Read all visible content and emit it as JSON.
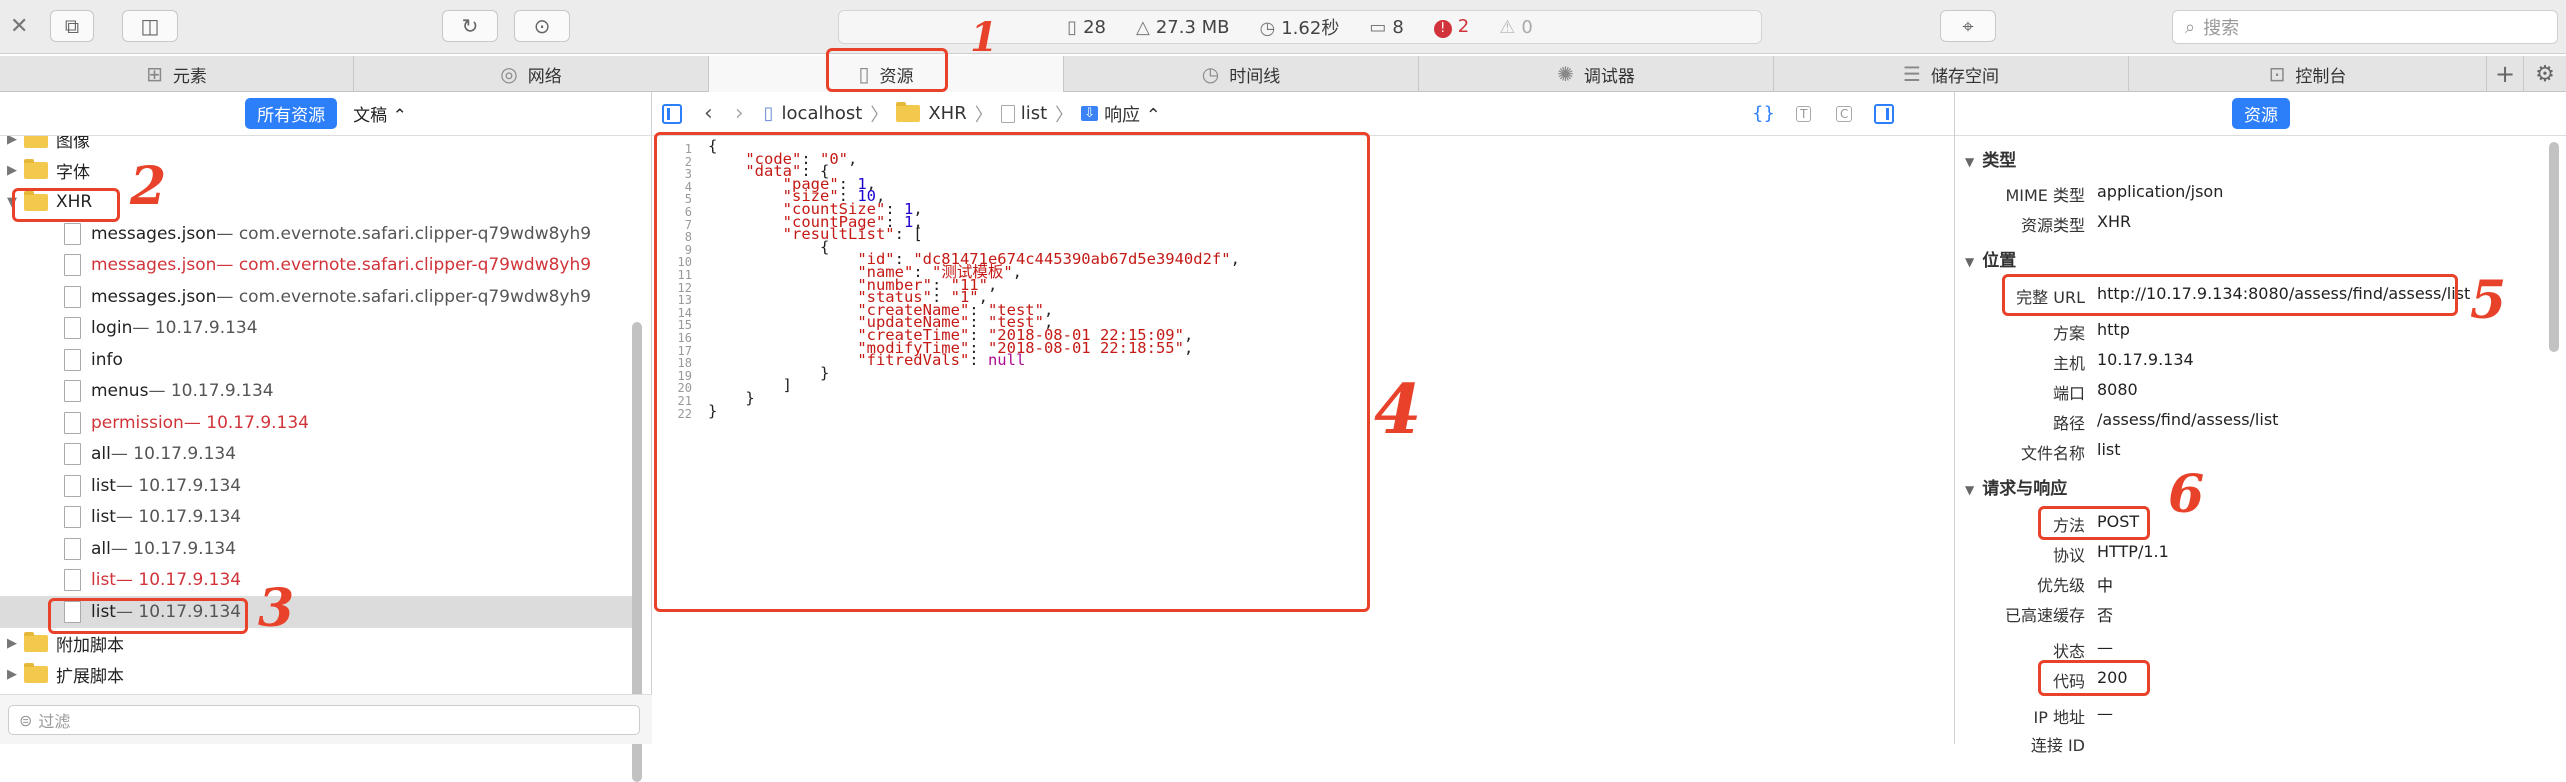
{
  "toolbar": {
    "stats": {
      "requests": "28",
      "size": "27.3 MB",
      "time": "1.62秒",
      "logs": "8",
      "errors": "2",
      "warnings": "0"
    },
    "search_placeholder": "搜索"
  },
  "tabs": [
    {
      "label": "元素",
      "icon": "elements-icon"
    },
    {
      "label": "网络",
      "icon": "network-icon"
    },
    {
      "label": "资源",
      "icon": "resources-icon"
    },
    {
      "label": "时间线",
      "icon": "timeline-icon"
    },
    {
      "label": "调试器",
      "icon": "debugger-icon"
    },
    {
      "label": "储存空间",
      "icon": "storage-icon"
    },
    {
      "label": "控制台",
      "icon": "console-icon"
    }
  ],
  "left": {
    "all_resources": "所有资源",
    "doc_filter": "文稿 ⌃",
    "tree": [
      {
        "label": "图像",
        "meta": "",
        "type": "folder",
        "red": false
      },
      {
        "label": "字体",
        "meta": "",
        "type": "folder",
        "red": false
      },
      {
        "label": "XHR",
        "meta": "",
        "type": "folder",
        "red": false
      },
      {
        "label": "messages.json",
        "meta": " — com.evernote.safari.clipper-q79wdw8yh9",
        "type": "file",
        "red": false
      },
      {
        "label": "messages.json",
        "meta": " — com.evernote.safari.clipper-q79wdw8yh9",
        "type": "file",
        "red": true
      },
      {
        "label": "messages.json",
        "meta": " — com.evernote.safari.clipper-q79wdw8yh9",
        "type": "file",
        "red": false
      },
      {
        "label": "login",
        "meta": " — 10.17.9.134",
        "type": "file",
        "red": false
      },
      {
        "label": "info",
        "meta": "",
        "type": "file",
        "red": false
      },
      {
        "label": "menus",
        "meta": " — 10.17.9.134",
        "type": "file",
        "red": false
      },
      {
        "label": "permission",
        "meta": " — 10.17.9.134",
        "type": "file",
        "red": true
      },
      {
        "label": "all",
        "meta": " — 10.17.9.134",
        "type": "file",
        "red": false
      },
      {
        "label": "list",
        "meta": " — 10.17.9.134",
        "type": "file",
        "red": false
      },
      {
        "label": "list",
        "meta": " — 10.17.9.134",
        "type": "file",
        "red": false
      },
      {
        "label": "all",
        "meta": " — 10.17.9.134",
        "type": "file",
        "red": false
      },
      {
        "label": "list",
        "meta": " — 10.17.9.134",
        "type": "file",
        "red": true
      },
      {
        "label": "list",
        "meta": " — 10.17.9.134",
        "type": "file",
        "red": false
      },
      {
        "label": "附加脚本",
        "meta": "",
        "type": "folder",
        "red": false
      },
      {
        "label": "扩展脚本",
        "meta": "",
        "type": "folder",
        "red": false
      }
    ],
    "filter_placeholder": "过滤"
  },
  "center": {
    "crumbs": [
      "localhost",
      "XHR",
      "list",
      "响应 ⌃"
    ],
    "code": [
      "{",
      "    \"code\": \"0\",",
      "    \"data\": {",
      "        \"page\": 1,",
      "        \"size\": 10,",
      "        \"countSize\": 1,",
      "        \"countPage\": 1,",
      "        \"resultList\": [",
      "            {",
      "                \"id\": \"dc81471e674c445390ab67d5e3940d2f\",",
      "                \"name\": \"测试模板\",",
      "                \"number\": \"11\",",
      "                \"status\": \"1\",",
      "                \"createName\": \"test\",",
      "                \"updateName\": \"test\",",
      "                \"createTime\": \"2018-08-01 22:15:09\",",
      "                \"modifyTime\": \"2018-08-01 22:18:55\",",
      "                \"fitredVals\": null",
      "            }",
      "        ]",
      "    }",
      "}"
    ]
  },
  "right": {
    "tab": "资源",
    "sec_type": "类型",
    "mime_k": "MIME 类型",
    "mime_v": "application/json",
    "rtype_k": "资源类型",
    "rtype_v": "XHR",
    "sec_loc": "位置",
    "url_k": "完整 URL",
    "url_v": "http://10.17.9.134:8080/assess/find/assess/list",
    "scheme_k": "方案",
    "scheme_v": "http",
    "host_k": "主机",
    "host_v": "10.17.9.134",
    "port_k": "端口",
    "port_v": "8080",
    "path_k": "路径",
    "path_v": "/assess/find/assess/list",
    "file_k": "文件名称",
    "file_v": "list",
    "sec_req": "请求与响应",
    "method_k": "方法",
    "method_v": "POST",
    "proto_k": "协议",
    "proto_v": "HTTP/1.1",
    "prio_k": "优先级",
    "prio_v": "中",
    "cache_k": "已高速缓存",
    "cache_v": "否",
    "status_k": "状态",
    "status_v": "—",
    "code_k": "代码",
    "code_v": "200",
    "ip_k": "IP 地址",
    "ip_v": "—",
    "conn_k": "连接 ID"
  },
  "annotations": [
    "1",
    "2",
    "3",
    "4",
    "5",
    "6"
  ],
  "colors": {
    "accent": "#2d7ff9",
    "annotation": "#e8422a",
    "error": "#d0343a"
  }
}
